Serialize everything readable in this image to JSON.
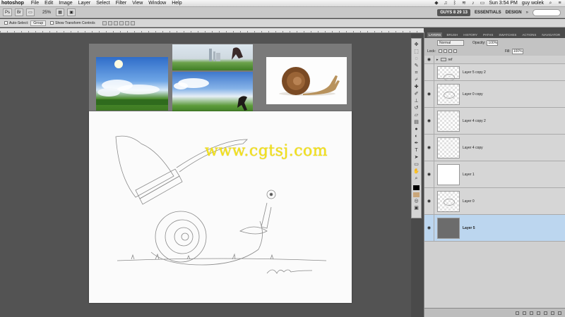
{
  "menubar": {
    "app_name": "hotoshop",
    "menus": [
      "File",
      "Edit",
      "Image",
      "Layer",
      "Select",
      "Filter",
      "View",
      "Window",
      "Help"
    ],
    "clock": "Sun 3:54 PM",
    "user": "guy wolek"
  },
  "appbar": {
    "zoom": "25%",
    "badge": "GUYS 8 29 13",
    "workspace_1": "ESSENTIALS",
    "workspace_2": "DESIGN"
  },
  "options": {
    "auto_select_label": "Auto-Select:",
    "auto_select_value": "Group",
    "show_transform_label": "Show Transform Controls"
  },
  "canvas": {
    "watermark": "www.cgtsj.com"
  },
  "layers_panel": {
    "tabs": [
      "LAYERS",
      "BRUSH",
      "HISTORY",
      "PATHS",
      "SWATCHES",
      "ACTIONS",
      "NAVIGATOR"
    ],
    "blend_mode": "Normal",
    "opacity_label": "Opacity:",
    "opacity_value": "100%",
    "lock_label": "Lock:",
    "fill_label": "Fill:",
    "fill_value": "100%",
    "folder_name": "ref",
    "layers": [
      {
        "name": "Layer 5 copy 2",
        "thumb": "sketch"
      },
      {
        "name": "Layer 0 copy",
        "thumb": "sketch"
      },
      {
        "name": "Layer 4 copy 2",
        "thumb": "checker"
      },
      {
        "name": "Layer 4 copy",
        "thumb": "checker"
      },
      {
        "name": "Layer 1",
        "thumb": "white"
      },
      {
        "name": "Layer 0",
        "thumb": "sketch"
      },
      {
        "name": "Layer 5",
        "thumb": "dark",
        "selected": true
      }
    ]
  }
}
